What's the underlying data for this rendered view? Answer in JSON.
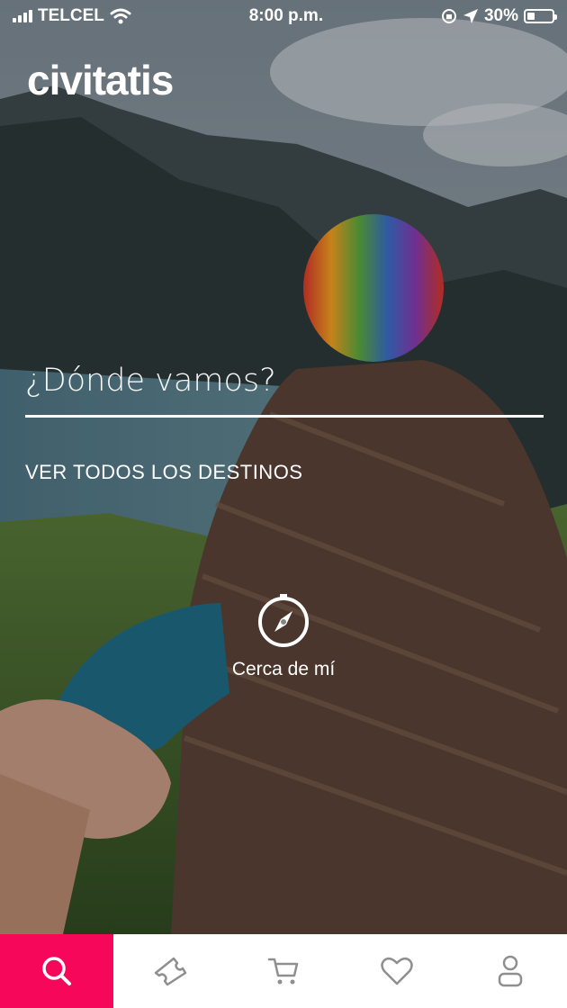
{
  "status_bar": {
    "carrier": "TELCEL",
    "time": "8:00 p.m.",
    "battery": "30%",
    "battery_level": 0.3
  },
  "app": {
    "logo_text": "civitatis"
  },
  "search": {
    "placeholder": "¿Dónde vamos?",
    "all_destinations_label": "VER TODOS LOS DESTINOS"
  },
  "near_me": {
    "label": "Cerca de mí",
    "icon": "compass-icon"
  },
  "tab_bar": {
    "active_color": "#f70759",
    "tabs": [
      {
        "name": "search",
        "icon": "search-icon",
        "active": true
      },
      {
        "name": "tickets",
        "icon": "ticket-icon",
        "active": false
      },
      {
        "name": "cart",
        "icon": "cart-icon",
        "active": false
      },
      {
        "name": "favorites",
        "icon": "heart-icon",
        "active": false
      },
      {
        "name": "profile",
        "icon": "user-icon",
        "active": false
      }
    ]
  }
}
